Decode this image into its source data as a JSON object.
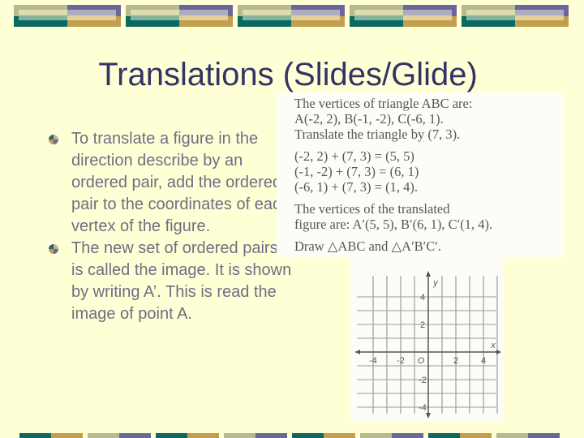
{
  "slide": {
    "title": "Translations (Slides/Glide)",
    "bullets": [
      {
        "icon": "quadrant-circle-bullet-icon",
        "text": "To translate a figure in the direction describe by an ordered pair, add the ordered pair to the coordinates of each vertex of the figure."
      },
      {
        "icon": "quadrant-circle-bullet-icon",
        "text": "The new set of ordered pairs is called the image. It is shown by writing A’. This is read the image of point A."
      }
    ]
  },
  "example": {
    "lines_intro": [
      "The vertices of triangle ABC are:",
      "A(-2, 2), B(-1, -2), C(-6, 1).",
      "Translate the triangle by (7, 3)."
    ],
    "lines_calc": [
      "(-2, 2) + (7, 3) = (5, 5)",
      "(-1, -2) + (7, 3) = (6, 1)",
      "(-6, 1) + (7, 3) = (1, 4)."
    ],
    "lines_result": [
      "The vertices of the translated",
      "figure are: A′(5, 5), B′(6, 1), C′(1, 4)."
    ],
    "line_draw": "Draw △ABC and △A′B′C′."
  },
  "graph": {
    "x_label": "x",
    "y_label": "y",
    "origin_label": "O",
    "x_ticks": [
      "-4",
      "-2",
      "2",
      "4"
    ],
    "y_ticks": [
      "4",
      "2",
      "-2",
      "-4"
    ]
  },
  "colors": {
    "title": "#333366",
    "body_text": "#6e6e84",
    "background": "#ffffd6",
    "teal": "#0a6a62",
    "gold": "#c39e4d",
    "sage": "#b9b98f",
    "purple": "#6b679e"
  }
}
